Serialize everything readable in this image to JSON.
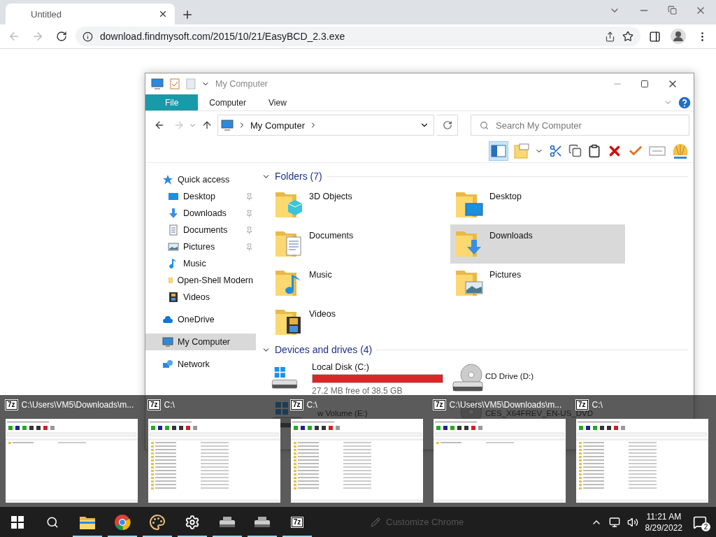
{
  "browser": {
    "tab": {
      "title": "Untitled"
    },
    "url": "download.findmysoft.com/2015/10/21/EasyBCD_2.3.exe"
  },
  "explorer": {
    "title": "My Computer",
    "ribbon_tabs": [
      {
        "label": "File",
        "selected": true
      },
      {
        "label": "Computer",
        "selected": false
      },
      {
        "label": "View",
        "selected": false
      }
    ],
    "address": "My Computer",
    "search": {
      "placeholder": "Search My Computer"
    },
    "nav_pane": [
      {
        "label": "Quick access",
        "selected": false,
        "children": [
          {
            "label": "Desktop",
            "pinned": true
          },
          {
            "label": "Downloads",
            "pinned": true
          },
          {
            "label": "Documents",
            "pinned": true
          },
          {
            "label": "Pictures",
            "pinned": true
          },
          {
            "label": "Music",
            "pinned": false
          },
          {
            "label": "Open-Shell Modern",
            "pinned": false
          },
          {
            "label": "Videos",
            "pinned": false
          }
        ]
      },
      {
        "label": "OneDrive",
        "selected": false
      },
      {
        "label": "My Computer",
        "selected": true
      },
      {
        "label": "Network",
        "selected": false
      }
    ],
    "folders_heading": "Folders (7)",
    "folders": [
      {
        "name": "3D Objects",
        "selected": false
      },
      {
        "name": "Desktop",
        "selected": false
      },
      {
        "name": "Documents",
        "selected": false
      },
      {
        "name": "Downloads",
        "selected": true
      },
      {
        "name": "Music",
        "selected": false
      },
      {
        "name": "Pictures",
        "selected": false
      },
      {
        "name": "Videos",
        "selected": false
      }
    ],
    "drives_heading": "Devices and drives (4)",
    "drives": [
      {
        "kind": "disk",
        "name": "Local Disk (C:)",
        "level": 0.999,
        "free": "27.2 MB free of 38.5 GB"
      },
      {
        "kind": "cd",
        "name": "CD Drive (D:)"
      },
      {
        "kind": "disk",
        "name": "w Volume (E:)"
      },
      {
        "kind": "cd",
        "name": "CES_X64FREV_EN-US_DVD"
      }
    ]
  },
  "thumbnails": [
    {
      "app_label": "7z",
      "title": "C:\\Users\\VM5\\Downloads\\m..."
    },
    {
      "app_label": "7z",
      "title": "C:\\"
    },
    {
      "app_label": "7z",
      "title": "C:\\"
    },
    {
      "app_label": "7z",
      "title": "C:\\Users\\VM5\\Downloads\\m..."
    },
    {
      "app_label": "7z",
      "title": "C:\\"
    }
  ],
  "taskbar": {
    "apps": [
      {
        "kind": "explorer",
        "running": true
      },
      {
        "kind": "chrome",
        "running": true
      },
      {
        "kind": "paint",
        "running": true
      },
      {
        "kind": "settings",
        "running": true
      },
      {
        "kind": "drive",
        "running": true
      },
      {
        "kind": "drive",
        "running": true
      },
      {
        "kind": "sevenzip",
        "label": "7z",
        "running": true
      }
    ],
    "behind_text": "Customize Chrome",
    "time": "11:21 AM",
    "date": "8/29/2022",
    "notifications": "2"
  }
}
